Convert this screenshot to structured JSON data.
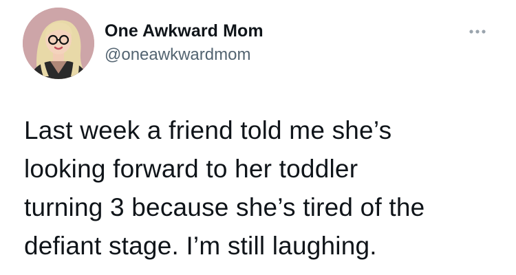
{
  "tweet": {
    "author": {
      "display_name": "One Awkward Mom",
      "handle": "@oneawkwardmom",
      "avatar_icon": "cartoon-woman-avatar"
    },
    "more_icon": "ellipsis-icon",
    "text_lines": [
      "Last week a friend told me she’s",
      "looking forward to her toddler",
      "turning 3 because she’s tired of the",
      "defiant stage. I’m still laughing."
    ]
  },
  "colors": {
    "text": "#0f1419",
    "secondary_text": "#536471",
    "avatar_bg": "#cda5a8"
  }
}
